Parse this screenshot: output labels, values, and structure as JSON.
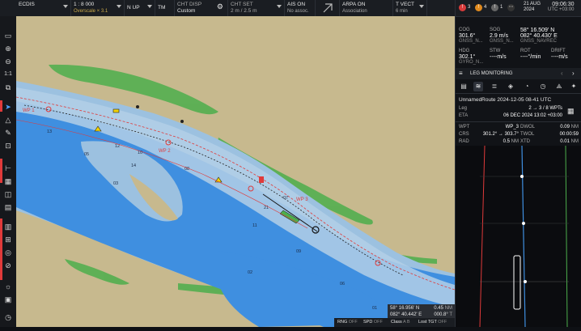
{
  "topbar": {
    "app": "ECDIS",
    "scale": "1 : 8 000",
    "scale_sub": "Overscale × 3.1",
    "orientation": "N UP",
    "motion": "TM",
    "chart_disp_label": "CHT DISP",
    "chart_disp_value": "Custom",
    "chart_set_label": "CHT SET",
    "chart_set_value": "2 m / 2.5 m",
    "ais_label": "AIS ON",
    "ais_sub": "No assoc.",
    "arpa_label": "ARPA ON",
    "arpa_sub": "Association",
    "tvect_label": "T VECT",
    "tvect_sub": "6 min"
  },
  "alarms": {
    "red_count": "3",
    "orange_count": "4",
    "white_count": "1",
    "date": "21 AUG",
    "year": "2024",
    "time": "09:06:30",
    "utc": "UTC +03:00"
  },
  "sensors": {
    "cog_label": "COG",
    "cog_value": "301.6°",
    "cog_src": "GNSS_N...",
    "sog_label": "SOG",
    "sog_value": "2.9 m/s",
    "sog_src": "GNSS_N...",
    "pos_lat": "58° 16.509' N",
    "pos_lon": "082° 40.430' E",
    "pos_src": "GNSS_NAVREC",
    "hdg_label": "HDG",
    "hdg_value": "302.1°",
    "hdg_src": "GYRO_N...",
    "stw_label": "STW",
    "stw_value": "----m/s",
    "rot_label": "ROT",
    "rot_value": "----°/min",
    "drift_label": "DRIFT",
    "drift_value": "----m/s"
  },
  "leg_monitoring": {
    "title": "LEG MONITORING",
    "route_name": "UnnamedRoute 2024-12-05 08-41 UTC",
    "leg_label": "Leg",
    "leg_value": "2 → 3 / 8 WPTs",
    "eta_label": "ETA",
    "eta_value": "06 DEC 2024 13:02 +03:00",
    "wpt_label": "WPT",
    "wpt_value": "WP_3",
    "dwol_label": "DWOL",
    "dwol_value": "0.09",
    "dwol_unit": "NM",
    "crs_label": "CRS",
    "crs_value": "301.2° → 303.7°",
    "twol_label": "TWOL",
    "twol_value": "00:00:59",
    "rad_label": "RAD",
    "rad_value": "0.5",
    "rad_unit": "NM",
    "xtd_label": "XTD",
    "xtd_value": "0.01",
    "xtd_unit": "NM"
  },
  "chart": {
    "wp_labels": [
      "WP 1",
      "WP 2",
      "WP 3"
    ],
    "depths": [
      "13",
      "12",
      "10",
      "05",
      "03",
      "14",
      "08",
      "11",
      "02",
      "21",
      "07",
      "09",
      "06",
      "01"
    ]
  },
  "position_box": {
    "lat": "58° 16.956' N",
    "lon": "082° 40.442' E",
    "rng": "0.45",
    "rng_unit": "NM",
    "brg": "000.8°",
    "brg_unit": "T"
  },
  "bottom_status": {
    "rng": "RNG",
    "rng_state": "OFF",
    "spd": "SPD",
    "spd_state": "OFF",
    "class": "Class",
    "class_state": "A B",
    "lost": "Lost TGT",
    "lost_state": "OFF"
  },
  "colors": {
    "land": "#c7b98e",
    "deep_water": "#3f8fe0",
    "shallow_water": "#9cc1e0",
    "fairway": "#b3cfe6",
    "vegetation": "#4cae4c",
    "route": "#e03a3a",
    "accent": "#4fa3ff"
  }
}
